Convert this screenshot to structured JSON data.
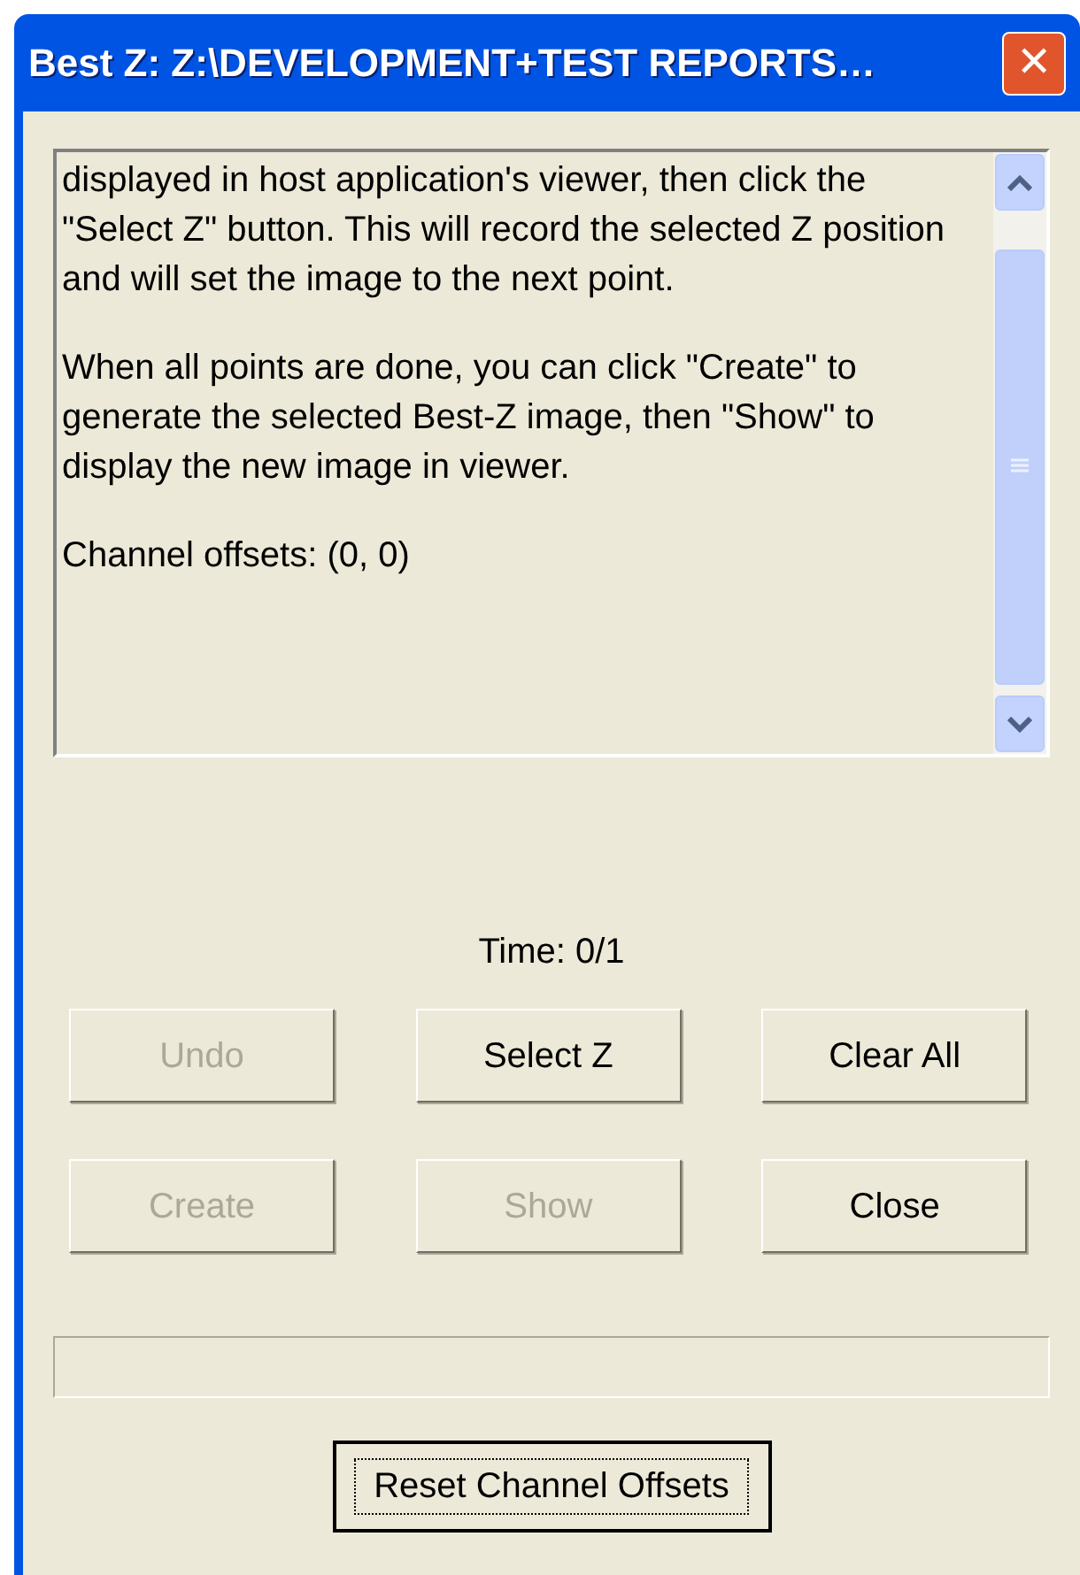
{
  "window": {
    "title": "Best Z: Z:\\DEVELOPMENT+TEST REPORTS…",
    "close_label": "✕"
  },
  "instructions": {
    "paragraphs": [
      "displayed in host application's viewer, then click the \"Select Z\" button.  This will record the selected Z position and will set the image to the next point.",
      "When all points are done, you can click \"Create\" to generate the selected Best-Z image, then \"Show\" to display the new image in viewer.",
      "Channel offsets: (0, 0)"
    ]
  },
  "time_label": "Time: 0/1",
  "buttons": [
    {
      "label": "Undo",
      "disabled": true
    },
    {
      "label": "Select Z",
      "disabled": false
    },
    {
      "label": "Clear All",
      "disabled": false
    },
    {
      "label": "Create",
      "disabled": true
    },
    {
      "label": "Show",
      "disabled": true
    },
    {
      "label": "Close",
      "disabled": false
    }
  ],
  "progress": {
    "level": 0
  },
  "reset_button": {
    "label": "Reset Channel Offsets",
    "focused": true
  }
}
